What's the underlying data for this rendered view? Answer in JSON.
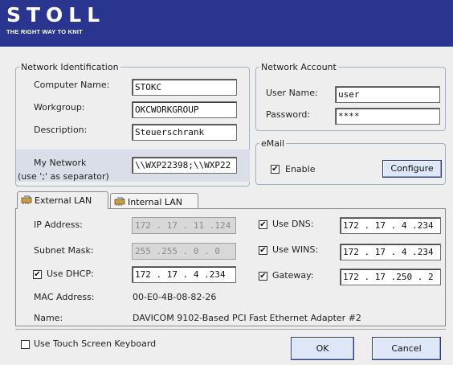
{
  "logo": {
    "brand": "STOLL",
    "tagline": "THE RIGHT WAY TO KNIT"
  },
  "network_identification": {
    "title": "Network Identification",
    "computer_name_label": "Computer Name:",
    "computer_name_value": "STOKC",
    "workgroup_label": "Workgroup:",
    "workgroup_value": "OKCWORKGROUP",
    "description_label": "Description:",
    "description_value": "Steuerschrank",
    "my_network_label": "My Network",
    "my_network_hint": "(use ';' as separator)",
    "my_network_value": "\\\\WXP22398;\\\\WXP22"
  },
  "network_account": {
    "title": "Network Account",
    "user_name_label": "User Name:",
    "user_name_value": "user",
    "password_label": "Password:",
    "password_value": "****"
  },
  "email": {
    "title": "eMail",
    "enable_label": "Enable",
    "enable_checked": true,
    "configure_label": "Configure"
  },
  "tabs": [
    {
      "label": "External LAN",
      "active": true
    },
    {
      "label": "Internal LAN",
      "active": false
    }
  ],
  "external_lan": {
    "ip_label": "IP Address:",
    "ip_value": "172 . 17 . 11 .124",
    "subnet_label": "Subnet Mask:",
    "subnet_value": "255 .255 . 0 . 0",
    "use_dhcp_label": "Use DHCP:",
    "use_dhcp_checked": true,
    "dhcp_value": "172 . 17 . 4 .234",
    "mac_label": "MAC Address:",
    "mac_value": "00-E0-4B-08-82-26",
    "name_label": "Name:",
    "name_value": "DAVICOM 9102-Based PCI Fast Ethernet Adapter #2",
    "use_dns_label": "Use DNS:",
    "use_dns_checked": true,
    "dns_value": "172 . 17 . 4 .234",
    "use_wins_label": "Use WINS:",
    "use_wins_checked": true,
    "wins_value": "172 . 17 . 4 .234",
    "gateway_label": "Gateway:",
    "gateway_checked": true,
    "gateway_value": "172 . 17 .250 . 2"
  },
  "footer": {
    "touch_keyboard_label": "Use Touch Screen Keyboard",
    "touch_keyboard_checked": false,
    "ok_label": "OK",
    "cancel_label": "Cancel"
  },
  "colors": {
    "banner": "#29358f",
    "group_border": "#9fb1c9",
    "button_face": "#dde7f7"
  },
  "icons": {
    "tab_icon": "network-card-icon",
    "check_mark": "✔"
  }
}
